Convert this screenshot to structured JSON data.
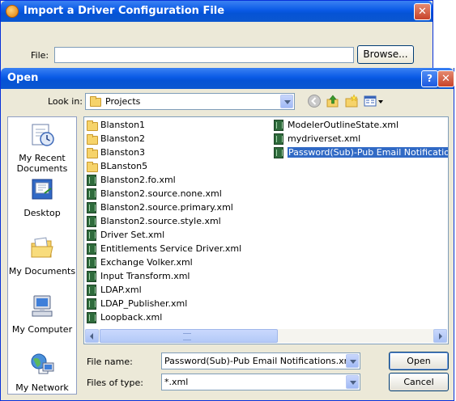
{
  "background_dialog": {
    "title": "Import a Driver Configuration File",
    "file_label": "File:",
    "file_value": "",
    "browse_label": "Browse...",
    "close_label": "✕"
  },
  "open_dialog": {
    "title": "Open",
    "help_label": "?",
    "close_label": "✕",
    "look_in_label": "Look in:",
    "look_in_value": "Projects",
    "places": [
      {
        "label": "My Recent Documents",
        "icon": "recent-documents-icon"
      },
      {
        "label": "Desktop",
        "icon": "desktop-icon"
      },
      {
        "label": "My Documents",
        "icon": "my-documents-icon"
      },
      {
        "label": "My Computer",
        "icon": "my-computer-icon"
      },
      {
        "label": "My Network",
        "icon": "my-network-icon"
      }
    ],
    "files": [
      {
        "name": "Blanston1",
        "kind": "folder"
      },
      {
        "name": "Blanston2",
        "kind": "folder"
      },
      {
        "name": "Blanston3",
        "kind": "folder"
      },
      {
        "name": "BLanston5",
        "kind": "folder"
      },
      {
        "name": "Blanston2.fo.xml",
        "kind": "xml"
      },
      {
        "name": "Blanston2.source.none.xml",
        "kind": "xml"
      },
      {
        "name": "Blanston2.source.primary.xml",
        "kind": "xml"
      },
      {
        "name": "Blanston2.source.style.xml",
        "kind": "xml"
      },
      {
        "name": "Driver Set.xml",
        "kind": "xml"
      },
      {
        "name": "Entitlements Service Driver.xml",
        "kind": "xml"
      },
      {
        "name": "Exchange Volker.xml",
        "kind": "xml"
      },
      {
        "name": "Input Transform.xml",
        "kind": "xml"
      },
      {
        "name": "LDAP.xml",
        "kind": "xml"
      },
      {
        "name": "LDAP_Publisher.xml",
        "kind": "xml"
      },
      {
        "name": "Loopback.xml",
        "kind": "xml"
      },
      {
        "name": "ModelerOutlineState.xml",
        "kind": "xml"
      },
      {
        "name": "mydriverset.xml",
        "kind": "xml"
      },
      {
        "name": "Password(Sub)-Pub Email Notifications.xml",
        "kind": "xml",
        "selected": true
      }
    ],
    "file_name_label": "File name:",
    "file_name_value": "Password(Sub)-Pub Email Notifications.xml",
    "files_of_type_label": "Files of type:",
    "files_of_type_value": "*.xml",
    "open_button": "Open",
    "cancel_button": "Cancel"
  },
  "colors": {
    "title_bar": "#0a5ae6",
    "dialog_face": "#ece9d8",
    "selection": "#316ac5"
  }
}
